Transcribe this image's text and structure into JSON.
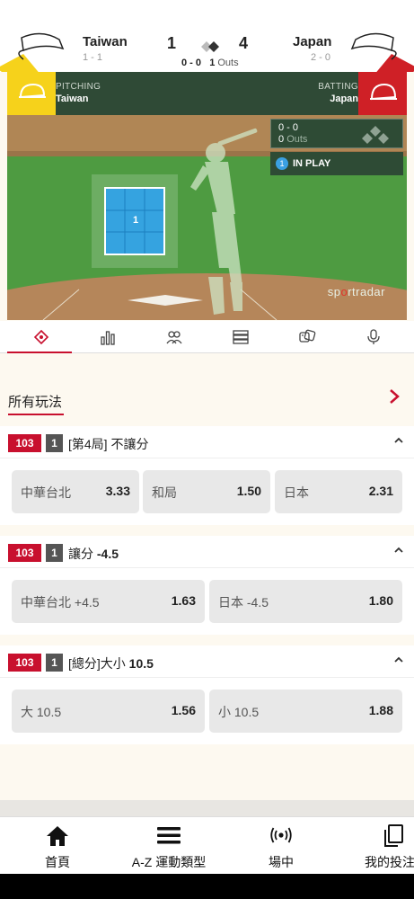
{
  "scoreboard": {
    "home_team": "Taiwan",
    "home_record": "1 - 1",
    "home_score": "1",
    "away_team": "Japan",
    "away_record": "2 - 0",
    "away_score": "4",
    "balls_strikes": "0 - 0",
    "outs_count": "1",
    "outs_label": "Outs"
  },
  "pitch_bar": {
    "left_label": "PITCHING",
    "left_team": "Taiwan",
    "right_label": "BATTING",
    "right_team": "Japan",
    "left_color": "#f6d21b",
    "right_color": "#cf2026"
  },
  "field": {
    "count_line1": "0 - 0",
    "count_outs_num": "0",
    "count_outs_label": "Outs",
    "inplay_number": "1",
    "inplay_text": "IN PLAY",
    "zone_number": "1",
    "brand_pre": "sp",
    "brand_o": "o",
    "brand_post": "rtradar"
  },
  "tabs": [
    {
      "icon": "baseball-field-icon"
    },
    {
      "icon": "stats-bars-icon"
    },
    {
      "icon": "lineup-people-icon"
    },
    {
      "icon": "list-rows-icon"
    },
    {
      "icon": "dice-icon"
    },
    {
      "icon": "microphone-icon"
    }
  ],
  "all_bets": {
    "title": "所有玩法"
  },
  "markets": [
    {
      "badge_id": "103",
      "badge_num": "1",
      "title_pre": "[第4局] 不讓分",
      "title_bold": "",
      "odds": [
        {
          "label": "中華台北",
          "value": "3.33"
        },
        {
          "label": "和局",
          "value": "1.50"
        },
        {
          "label": "日本",
          "value": "2.31"
        }
      ]
    },
    {
      "badge_id": "103",
      "badge_num": "1",
      "title_pre": "讓分 ",
      "title_bold": "-4.5",
      "odds": [
        {
          "label": "中華台北 +4.5",
          "value": "1.63"
        },
        {
          "label": "日本 -4.5",
          "value": "1.80"
        }
      ]
    },
    {
      "badge_id": "103",
      "badge_num": "1",
      "title_pre": "[總分]大小 ",
      "title_bold": "10.5",
      "odds": [
        {
          "label": "大 10.5",
          "value": "1.56"
        },
        {
          "label": "小 10.5",
          "value": "1.88"
        }
      ]
    }
  ],
  "bottom_nav": [
    {
      "label": "首頁",
      "icon": "home-icon"
    },
    {
      "label": "A-Z 運動類型",
      "icon": "menu-icon"
    },
    {
      "label": "場中",
      "icon": "live-broadcast-icon"
    },
    {
      "label": "我的投注",
      "icon": "my-bets-icon"
    }
  ]
}
